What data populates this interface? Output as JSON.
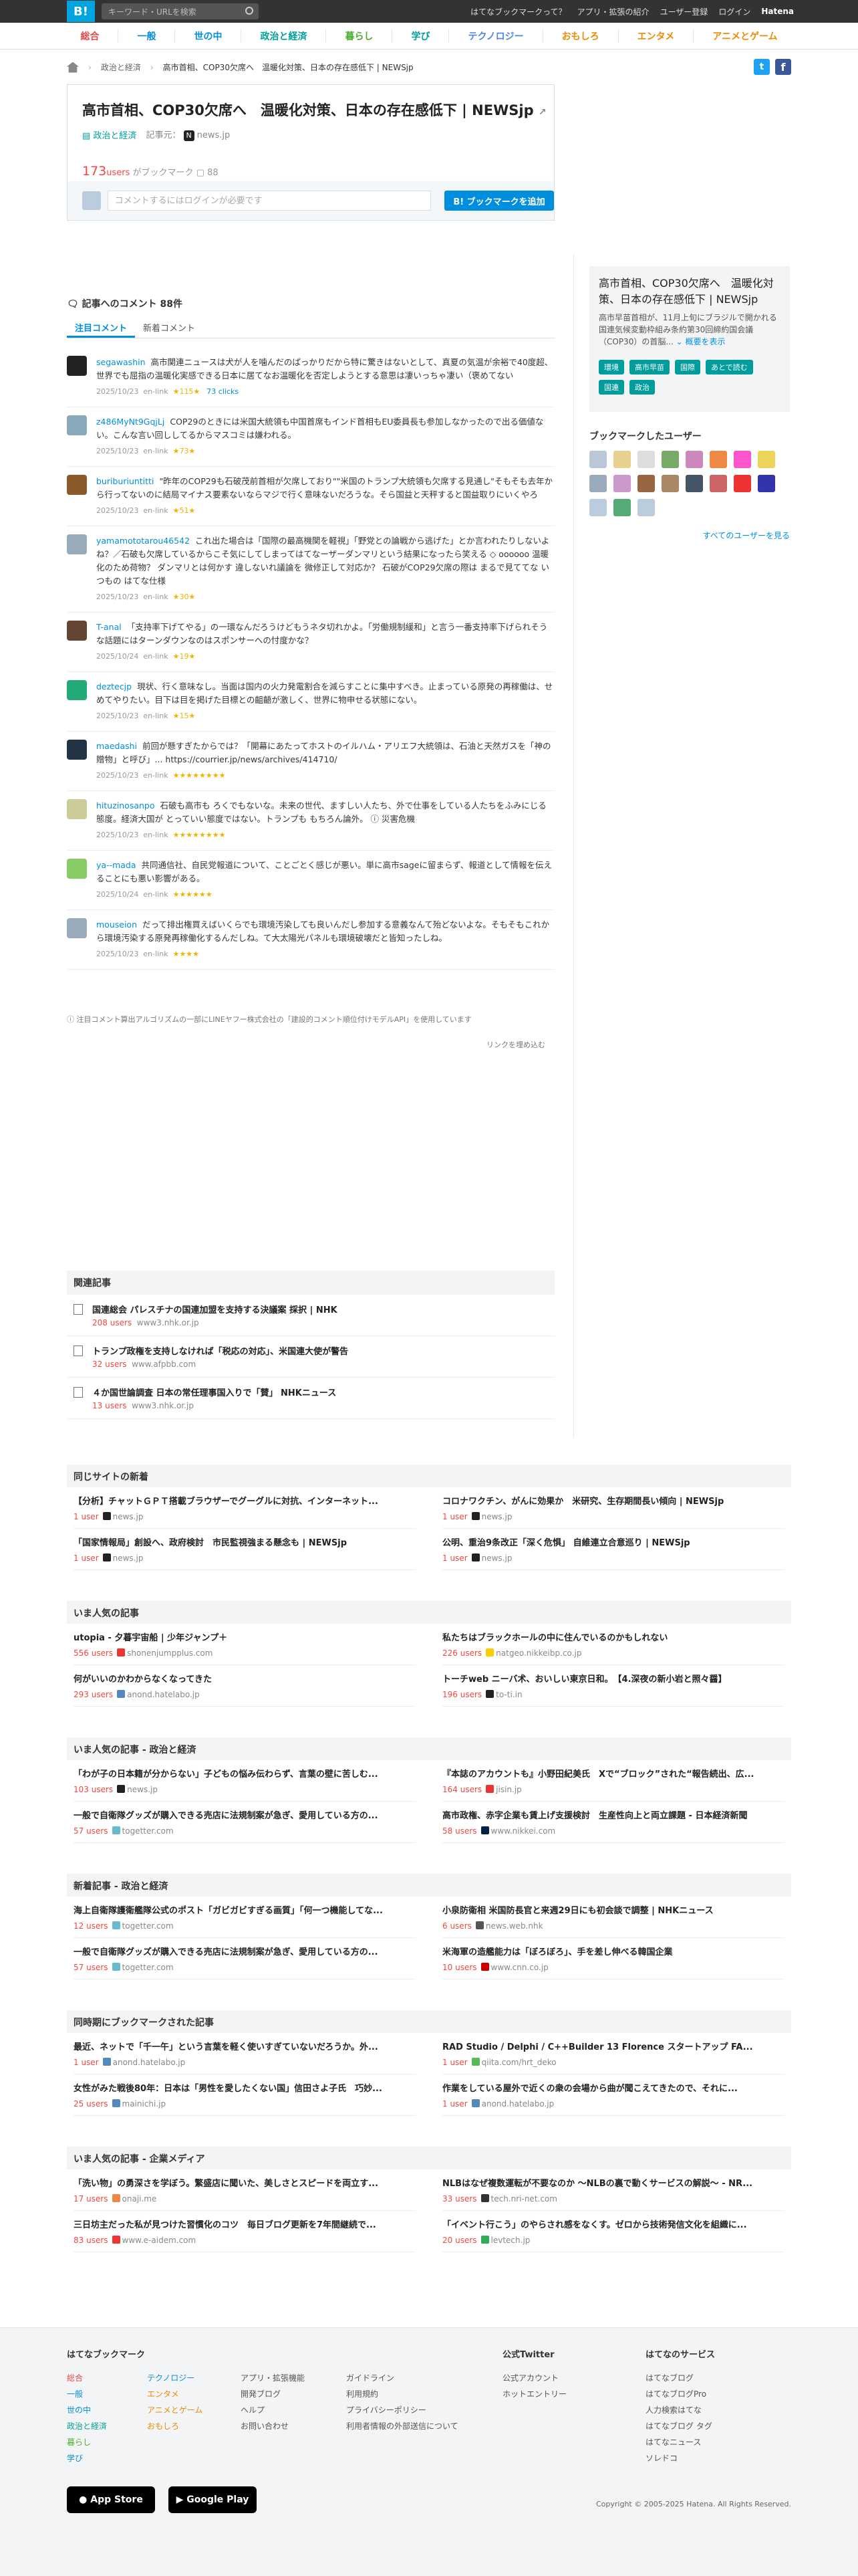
{
  "topbar": {
    "logo": "B!",
    "search_placeholder": "キーワード・URLを検索",
    "links": [
      "はてなブックマークって？",
      "アプリ・拡張の紹介",
      "ユーザー登録",
      "ログイン"
    ],
    "hatena": "Hatena"
  },
  "categories": [
    "総合",
    "一般",
    "世の中",
    "政治と経済",
    "暮らし",
    "学び",
    "テクノロジー",
    "おもしろ",
    "エンタメ",
    "アニメとゲーム"
  ],
  "breadcrumb": [
    "政治と経済",
    "高市首相、COP30欠席へ　温暖化対策、日本の存在感低下 | NEWSjp"
  ],
  "entry": {
    "title": "高市首相、COP30欠席へ　温暖化対策、日本の存在感低下 | NEWSjp",
    "category": "政治と経済",
    "posted_label": "記事元：",
    "source": "news.jp",
    "users": "173",
    "users_label": "users",
    "bm_label": "がブックマーク",
    "comment_count": "88",
    "comment_placeholder": "コメントするにはログインが必要です",
    "bm_button": "B! ブックマークを追加"
  },
  "summary": {
    "title": "高市首相、COP30欠席へ　温暖化対策、日本の存在感低下 | NEWSjp",
    "body": "高市早苗首相が、11月上旬にブラジルで開かれる国連気候変動枠組み条約第30回締約国会議（COP30）の首脳...",
    "more": "概要を表示",
    "tags": [
      "環境",
      "高市早苗",
      "国際",
      "あとで読む",
      "国連",
      "政治"
    ]
  },
  "users_box": {
    "title": "ブックマークしたユーザー",
    "all": "すべてのユーザーを見る"
  },
  "comments_header": {
    "label": "記事へのコメント",
    "count": "88",
    "unit": "件"
  },
  "tabs": [
    "注目コメント",
    "新着コメント"
  ],
  "comments": [
    {
      "user": "segawashin",
      "text": "高市関連ニュースは犬が人を噛んだのぱっかりだから特に驚きはないとして、真夏の気温が余裕で40度超、世界でも屈指の温暖化実感できる日本に居てなお温暖化を否定しようとする意思は凄いっちゃ凄い（褒めてない",
      "date": "2025/10/23",
      "ref": "en-link",
      "stars": "★115★",
      "clicks": "73 clicks",
      "color": "#222"
    },
    {
      "user": "z486MyNt9GqjLj",
      "text": "COP29のときには米国大統領も中国首席もインド首相もEU委員長も参加しなかったので出る価値ない。こんな言い回ししてるからマスコミは嫌われる。",
      "date": "2025/10/23",
      "ref": "en-link",
      "stars": "★73★",
      "clicks": "",
      "color": "#8ab"
    },
    {
      "user": "buriburiuntitti",
      "text": "\"昨年のCOP29も石破茂前首相が欠席しており\"\"米国のトランプ大統領も欠席する見通し\"そもそも去年から行ってないのに結局マイナス要素ないならマジで行く意味ないだろうな。そら国益と天秤すると国益取りにいくやろ",
      "date": "2025/10/23",
      "ref": "en-link",
      "stars": "★51★",
      "clicks": "",
      "color": "#8a5a2a"
    },
    {
      "user": "yamamototarou46542",
      "text": "これ出た場合は「国際の最高機関を軽視」「野党との論戦から逃げた」とか言われたりしないよね？／石破も欠席しているからこそ気にしてしまってはてなーザーダンマリという結果になったら笑える ◇ oooooo 温暖化のため荷物？ ダンマリとは何かす 違しないれ議論を 微修正して対応か？ 石破がCOP29欠席の際は まるで見ててな いつもの はてな仕様",
      "date": "2025/10/23",
      "ref": "en-link",
      "stars": "★30★",
      "clicks": "",
      "color": "#9ab"
    },
    {
      "user": "T-anal",
      "text": "「支持率下げてやる」の一環なんだろうけどもうネタ切れかよ。「労働規制緩和」と言う一番支持率下げられそうな話題にはターンダウンなのはスポンサーへの忖度かな？",
      "date": "2025/10/24",
      "ref": "en-link",
      "stars": "★19★",
      "clicks": "",
      "color": "#643"
    },
    {
      "user": "deztecjp",
      "text": "現状、行く意味なし。当面は国内の火力発電割合を減らすことに集中すべき。止まっている原発の再稼働は、せめてやりたい。目下は目を掲げた目標との齟齬が激しく、世界に物申せる状態にない。",
      "date": "2025/10/23",
      "ref": "en-link",
      "stars": "★15★",
      "clicks": "",
      "color": "#2a7"
    },
    {
      "user": "maedashi",
      "text": "前回が懸すぎたからでは？「開幕にあたってホストのイルハム・アリエフ大統領は、石油と天然ガスを「神の贈物」と呼び」... https://courrier.jp/news/archives/414710/",
      "date": "2025/10/23",
      "ref": "en-link",
      "stars": "★★★★★★★★",
      "clicks": "",
      "color": "#234"
    },
    {
      "user": "hituzinosanpo",
      "text": "石破も高市も ろくでもないな。未来の世代、ますしい人たち、外で仕事をしている人たちをふみにじる態度。経済大国が とっていい態度ではない。トランプも もちろん論外。 ⓘ 災害危機",
      "date": "2025/10/23",
      "ref": "en-link",
      "stars": "★★★★★★★★",
      "clicks": "",
      "color": "#cc9"
    },
    {
      "user": "ya--mada",
      "text": "共同通信社、自民党報道について、ことごとく感じが悪い。単に高市sageに留まらず、報道として情報を伝えることにも悪い影響がある。",
      "date": "2025/10/24",
      "ref": "en-link",
      "stars": "★★★★★★",
      "clicks": "",
      "color": "#8c6"
    },
    {
      "user": "mouseion",
      "text": "だって排出権買えばいくらでも環境汚染しても良いんだし参加する意義なんて殆どないよな。そもそもこれから環境汚染する原発再稼働化するんだしね。て大太陽光パネルも環境破壊だと皆知ったしね。",
      "date": "2025/10/23",
      "ref": "en-link",
      "stars": "★★★★",
      "clicks": "",
      "color": "#9ab"
    }
  ],
  "note": "ⓘ 注目コメント算出アルゴリズムの一部にLINEヤフー株式会社の「建設的コメント順位付けモデルAPI」を使用しています",
  "link_embed": "リンクを埋め込む",
  "related": {
    "title": "関連記事",
    "items": [
      {
        "title": "国連総会 パレスチナの国連加盟を支持する決議案 採択 | NHK",
        "users": "208 users",
        "site": "www3.nhk.or.jp"
      },
      {
        "title": "トランプ政権を支持しなければ「税応の対応」、米国連大使が警告",
        "users": "32 users",
        "site": "www.afpbb.com"
      },
      {
        "title": "４か国世論調査 日本の常任理事国入りで「賛」 NHKニュース",
        "users": "13 users",
        "site": "www3.nhk.or.jp"
      }
    ]
  },
  "sections": [
    {
      "title": "同じサイトの新着",
      "items": [
        {
          "title": "【分析】チャットＧＰＴ搭載ブラウザーでグーグルに対抗、インターネット...",
          "users": "1 user",
          "site": "news.jp",
          "fav": "#222"
        },
        {
          "title": "コロナワクチン、がんに効果か　米研究、生存期間長い傾向 | NEWSjp",
          "users": "1 user",
          "site": "news.jp",
          "fav": "#222"
        },
        {
          "title": "「国家情報局」創設へ、政府検討　市民監視強まる懸念も | NEWSjp",
          "users": "1 user",
          "site": "news.jp",
          "fav": "#222"
        },
        {
          "title": "公明、重治9条改正「深く危惧」 自維連立合意巡り | NEWSjp",
          "users": "1 user",
          "site": "news.jp",
          "fav": "#222"
        }
      ]
    },
    {
      "title": "いま人気の記事",
      "items": [
        {
          "title": "utopia - 夕暮宇宙船 | 少年ジャンプ＋",
          "users": "556 users",
          "site": "shonenjumpplus.com",
          "fav": "#e33"
        },
        {
          "title": "私たちはブラックホールの中に住んでいるのかもしれない",
          "users": "226 users",
          "site": "natgeo.nikkeibp.co.jp",
          "fav": "#fc0"
        },
        {
          "title": "何がいいのかわからなくなってきた",
          "users": "293 users",
          "site": "anond.hatelabo.jp",
          "fav": "#58b"
        },
        {
          "title": "トーチweb ニーバ术、おいしい東京日和。　【4.深夜の新小岩と照々醤】",
          "users": "196 users",
          "site": "to-ti.in",
          "fav": "#222"
        }
      ]
    },
    {
      "title": "いま人気の記事 - 政治と経済",
      "items": [
        {
          "title": "「わが子の日本籍が分からない」子どもの悩み伝わらず、言葉の壁に苦しむ...",
          "users": "103 users",
          "site": "news.jp",
          "fav": "#222"
        },
        {
          "title": "『本誌のアカウントも』小野田紀美氏　Xで“ブロック”された“報告続出、広...",
          "users": "164 users",
          "site": "jisin.jp",
          "fav": "#e33"
        },
        {
          "title": "一般で自衛隊グッズが購入できる売店に法規制案が急ぎ、愛用している方の...",
          "users": "57 users",
          "site": "togetter.com",
          "fav": "#6bc"
        },
        {
          "title": "高市政権、赤字企業も賃上げ支援検討　生産性向上と両立課題 - 日本経済新聞",
          "users": "58 users",
          "site": "www.nikkei.com",
          "fav": "#024"
        }
      ]
    },
    {
      "title": "新着記事 - 政治と経済",
      "items": [
        {
          "title": "海上自衛隊護衛艦隊公式のポスト「ガビガビすぎる画質」「何一つ機能してな...",
          "users": "12 users",
          "site": "togetter.com",
          "fav": "#6bc"
        },
        {
          "title": "小泉防衛相 米国防長官と来週29日にも初会談で調整 | NHKニュース",
          "users": "6 users",
          "site": "news.web.nhk",
          "fav": "#555"
        },
        {
          "title": "一般で自衛隊グッズが購入できる売店に法規制案が急ぎ、愛用している方の...",
          "users": "57 users",
          "site": "togetter.com",
          "fav": "#6bc"
        },
        {
          "title": "米海軍の造艦能力は「ぼろぼろ」、手を差し伸べる韓国企業",
          "users": "10 users",
          "site": "www.cnn.co.jp",
          "fav": "#c00"
        }
      ]
    },
    {
      "title": "同時期にブックマークされた記事",
      "items": [
        {
          "title": "最近、ネットで「千一午」という言葉を軽く使いすぎていないだろうか。外...",
          "users": "1 user",
          "site": "anond.hatelabo.jp",
          "fav": "#58b"
        },
        {
          "title": "RAD Studio / Delphi / C++Builder 13 Florence スタートアップ FA...",
          "users": "1 user",
          "site": "qiita.com/hrt_deko",
          "fav": "#5b5"
        },
        {
          "title": "女性がみた戦後80年：日本は「男性を愛したくない国」信田さよ子氏　巧妙...",
          "users": "25 users",
          "site": "mainichi.jp",
          "fav": "#58b"
        },
        {
          "title": "作業をしている屋外で近くの衆の会場から曲が聞こえてきたので、それに...",
          "users": "1 user",
          "site": "anond.hatelabo.jp",
          "fav": "#58b"
        }
      ]
    },
    {
      "title": "いま人気の記事 - 企業メディア",
      "items": [
        {
          "title": "「洗い物」の勇深さを学ぼう。繁盛店に聞いた、美しさとスピードを両立す...",
          "users": "17 users",
          "site": "onaji.me",
          "fav": "#e84"
        },
        {
          "title": "NLBはなぜ複数運転が不要なのか 〜NLBの裏で動くサービスの解説〜 - NR...",
          "users": "33 users",
          "site": "tech.nri-net.com",
          "fav": "#333"
        },
        {
          "title": "三日坊主だった私が見つけた習慣化のコツ　毎日ブログ更新を7年間継続で...",
          "users": "83 users",
          "site": "www.e-aidem.com",
          "fav": "#e33"
        },
        {
          "title": "「イベント行こう」のやらされ感をなくす。ゼロから技術発信文化を組織に...",
          "users": "20 users",
          "site": "levtech.jp",
          "fav": "#3a5"
        }
      ]
    }
  ],
  "footer": {
    "col1_title": "はてなブックマーク",
    "col1a": [
      "総合",
      "一般",
      "世の中",
      "政治と経済",
      "暮らし",
      "学び"
    ],
    "col1b": [
      "テクノロジー",
      "エンタメ",
      "アニメとゲーム",
      "おもしろ"
    ],
    "col2": [
      "アプリ・拡張機能",
      "開発ブログ",
      "ヘルプ",
      "お問い合わせ"
    ],
    "col3": [
      "ガイドライン",
      "利用規約",
      "プライバシーポリシー",
      "利用者情報の外部送信について"
    ],
    "col4_title": "公式Twitter",
    "col4": [
      "公式アカウント",
      "ホットエントリー"
    ],
    "col5_title": "はてなのサービス",
    "col5": [
      "はてなブログ",
      "はてなブログPro",
      "人力検索はてな",
      "はてなブログ タグ",
      "はてなニュース",
      "ソレドコ"
    ],
    "appstore": "App Store",
    "googleplay": "Google Play",
    "copyright": "Copyright © 2005-2025 Hatena. All Rights Reserved."
  },
  "colors": {
    "accent": "#008fde",
    "users": "#f2473f",
    "tag": "#009d9c"
  }
}
